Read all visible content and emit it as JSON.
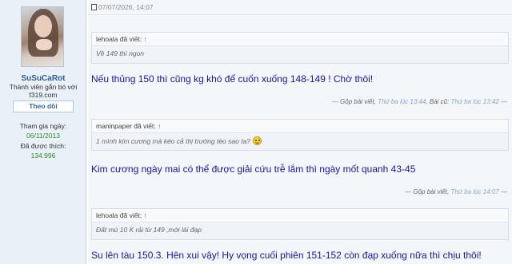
{
  "user": {
    "name": "SuSuCaRot",
    "title": "Thành viên gắn bó với f319.com",
    "follow_label": "Theo dõi",
    "joined_label": "Tham gia ngày:",
    "joined_value": "06/11/2013",
    "likes_label": "Đã được thích:",
    "likes_value": "134.996"
  },
  "post": {
    "date": "07/07/2026, 14:07",
    "blocks": [
      {
        "quote_author": "lehoala đã viết:",
        "quote_arrow": "↑",
        "quote_text": "Về 149 thì ngon",
        "message": "Nếu thủng 150 thì cũng kg khó để cuốn xuống 148-149 ! Chờ thôi!",
        "merge_prefix": "--- Gộp bài viết,",
        "merge_time": "Thứ ba lúc 13:44",
        "merge_mid": ", Bài cũ:",
        "merge_time2": "Thứ ba lúc 13:42",
        "merge_suffix": "---"
      },
      {
        "quote_author": "maninpaper đã viết:",
        "quote_arrow": "↑",
        "quote_text": "1 mình kim cương mà kéo cả thị trường tèo sao ta?",
        "message": "Kim cương ngày mai có thể được giải cứu trễ lắm thì ngày mốt quanh 43-45",
        "merge_prefix": "--- Gộp bài viết,",
        "merge_time": "Thứ ba lúc 14:07",
        "merge_suffix": "---"
      },
      {
        "quote_author": "lehoala đã viết:",
        "quote_arrow": "↑",
        "quote_text": "Đất mù 10 K rải từ 149 ,mới lái đạp",
        "message": "Su lên tàu 150.3. Hên xui vậy! Hy vọng cuối phiên 151-152 còn đạp xuống nữa thì chịu thôi!"
      }
    ]
  }
}
